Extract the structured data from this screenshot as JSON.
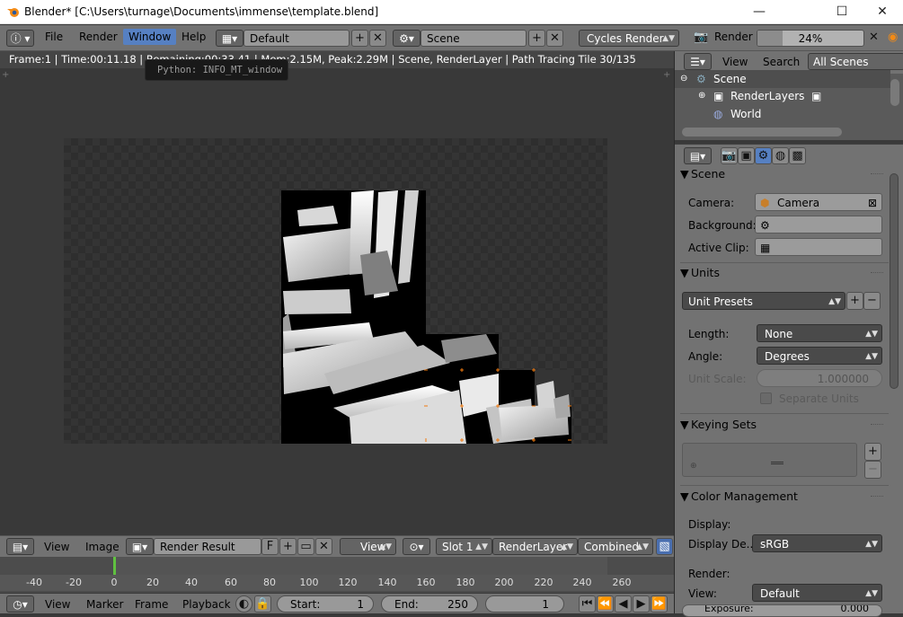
{
  "window": {
    "title": "Blender* [C:\\Users\\turnage\\Documents\\immense\\template.blend]",
    "controls": {
      "minimize": "—",
      "maximize": "☐",
      "close": "✕"
    }
  },
  "info_header": {
    "editor_icon": "info-icon",
    "menus": [
      "File",
      "Render",
      "Window",
      "Help"
    ],
    "active_menu": "Window",
    "screen_layout": "Default",
    "scene": "Scene",
    "render_engine": "Cycles Render",
    "render_label": "Render",
    "render_progress": "24%",
    "render_progress_fraction": 0.24
  },
  "status": {
    "text": "Frame:1 | Time:00:11.18 | Remaining:00:33.41 | Mem:2.15M, Peak:2.29M | Scene, RenderLayer | Path Tracing Tile 30/135"
  },
  "tooltip": {
    "text": "Python: INFO_MT_window"
  },
  "image_editor": {
    "menus": [
      "View",
      "Image"
    ],
    "image_name": "Render Result",
    "fake_user": "F",
    "view_mode": "View",
    "slot": "Slot 1",
    "render_layer": "RenderLayer",
    "pass": "Combined"
  },
  "timeline": {
    "ticks": [
      "-40",
      "-20",
      "0",
      "20",
      "40",
      "60",
      "80",
      "100",
      "120",
      "140",
      "160",
      "180",
      "200",
      "220",
      "240",
      "260"
    ],
    "current_frame_marker": 0,
    "menus": [
      "View",
      "Marker",
      "Frame",
      "Playback"
    ],
    "start_label": "Start:",
    "start": "1",
    "end_label": "End:",
    "end": "250",
    "current": "1"
  },
  "outliner": {
    "menus": [
      "View",
      "Search"
    ],
    "display_mode": "All Scenes",
    "items": [
      {
        "label": "Scene",
        "icon": "scene-icon"
      },
      {
        "label": "RenderLayers",
        "icon": "renderlayers-icon"
      },
      {
        "label": "World",
        "icon": "world-icon"
      }
    ]
  },
  "properties": {
    "scene_panel": {
      "title": "Scene",
      "camera_label": "Camera:",
      "camera_value": "Camera",
      "background_label": "Background:",
      "active_clip_label": "Active Clip:"
    },
    "units_panel": {
      "title": "Units",
      "presets": "Unit Presets",
      "length_label": "Length:",
      "length_value": "None",
      "angle_label": "Angle:",
      "angle_value": "Degrees",
      "scale_label": "Unit Scale:",
      "scale_value": "1.000000",
      "separate_label": "Separate Units"
    },
    "keying_panel": {
      "title": "Keying Sets"
    },
    "color_panel": {
      "title": "Color Management",
      "display_label": "Display:",
      "display_device_label": "Display De...",
      "display_device_value": "sRGB",
      "render_label": "Render:",
      "view_label": "View:",
      "view_value": "Default",
      "exposure_label": "Exposure:",
      "exposure_value": "0.000"
    }
  }
}
